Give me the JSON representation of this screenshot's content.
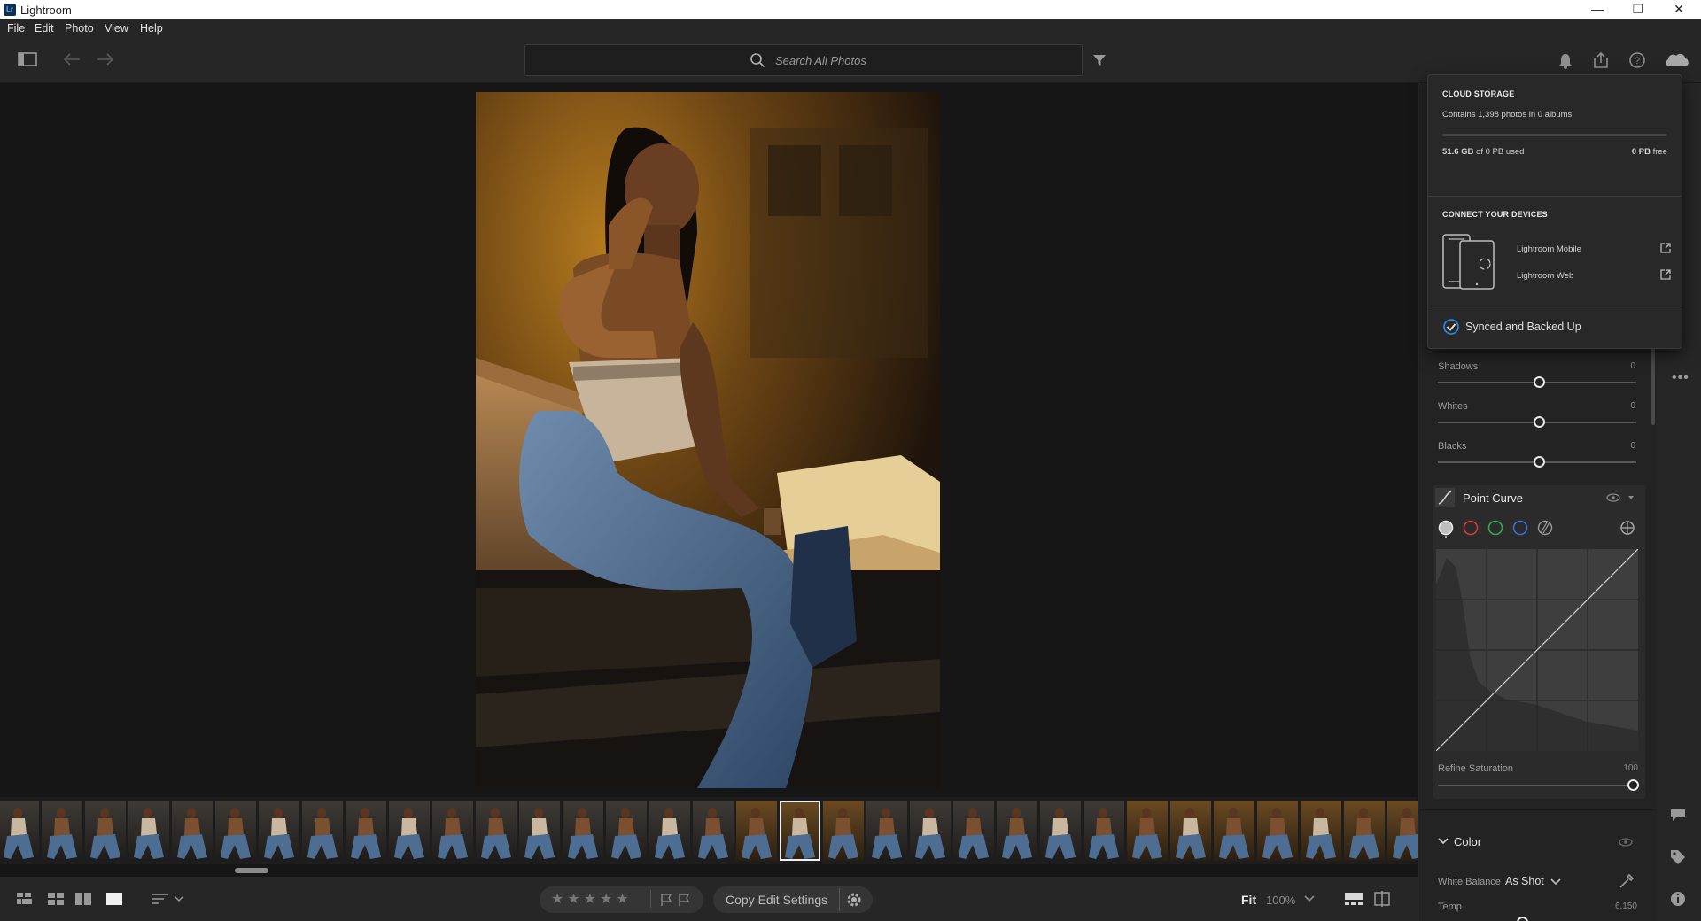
{
  "window": {
    "app_icon": "Lr",
    "title": "Lightroom",
    "minimize": "—",
    "restore": "❐",
    "close": "✕"
  },
  "menu": [
    "File",
    "Edit",
    "Photo",
    "View",
    "Help"
  ],
  "toolbar": {
    "search_placeholder": "Search All Photos"
  },
  "cloud_storage": {
    "heading": "CLOUD STORAGE",
    "contains": "Contains 1,398 photos in 0 albums.",
    "used_value": "51.6 GB",
    "used_suffix": " of 0 PB used",
    "free_value": "0 PB",
    "free_suffix": " free",
    "devices_heading": "CONNECT YOUR DEVICES",
    "device_links": [
      "Lightroom Mobile",
      "Lightroom Web"
    ],
    "sync_status": "Synced and Backed Up"
  },
  "light_panel": {
    "sliders": [
      {
        "label": "Shadows",
        "value": "0"
      },
      {
        "label": "Whites",
        "value": "0"
      },
      {
        "label": "Blacks",
        "value": "0"
      }
    ]
  },
  "point_curve": {
    "title": "Point Curve",
    "channel_colors": [
      "#cfcfcf",
      "#d23b3b",
      "#3aa84a",
      "#3b6fd6"
    ],
    "refine_label": "Refine Saturation",
    "refine_value": "100",
    "refine_level": 1.0
  },
  "color_panel": {
    "title": "Color",
    "wb_label": "White Balance",
    "wb_value": "As Shot",
    "temp_label": "Temp",
    "temp_value": "6,150"
  },
  "bottom_bar": {
    "copy_edit_settings": "Copy Edit Settings",
    "fit_label": "Fit",
    "zoom_value": "100%"
  },
  "filmstrip": {
    "thumbnail_count": 33,
    "selected_index": 18
  }
}
